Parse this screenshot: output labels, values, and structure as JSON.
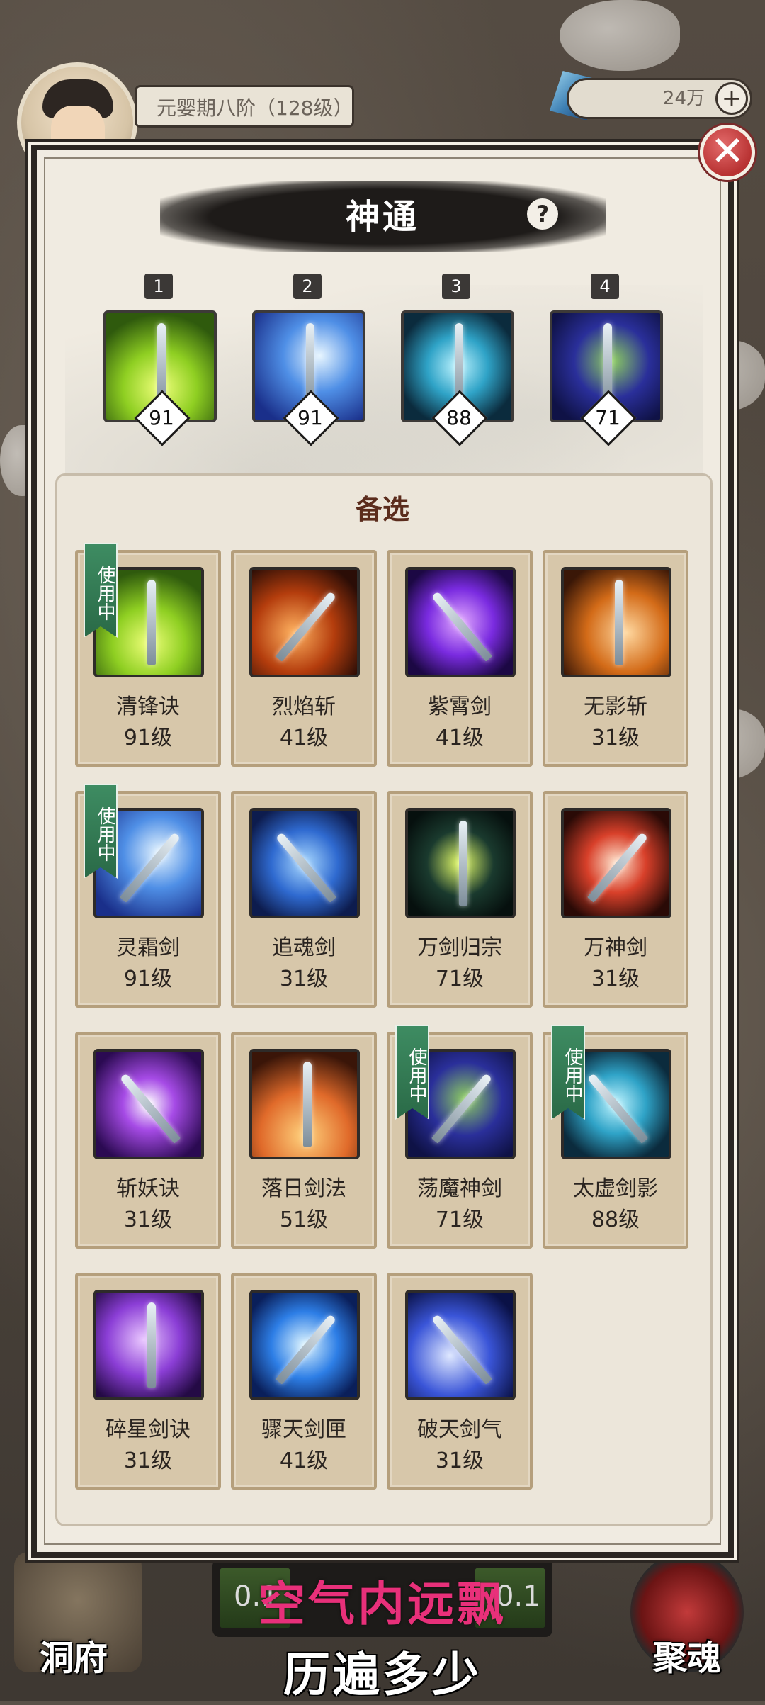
{
  "player": {
    "realm": "元婴期八阶（128级）"
  },
  "currency": {
    "amount": "24万",
    "add_label": "+"
  },
  "modal": {
    "title": "神通",
    "help": "?",
    "close": "✕",
    "candidate_title": "备选"
  },
  "equipped": [
    {
      "slot": "1",
      "level": "91",
      "art": "green"
    },
    {
      "slot": "2",
      "level": "91",
      "art": "ice"
    },
    {
      "slot": "3",
      "level": "88",
      "art": "cyan"
    },
    {
      "slot": "4",
      "level": "71",
      "art": "violet"
    }
  ],
  "in_use_label": "使用中",
  "candidates": [
    {
      "name": "清锋诀",
      "level": "91级",
      "in_use": true,
      "art": "green"
    },
    {
      "name": "烈焰斩",
      "level": "41级",
      "in_use": false,
      "art": "fire"
    },
    {
      "name": "紫霄剑",
      "level": "41级",
      "in_use": false,
      "art": "purple"
    },
    {
      "name": "无影斩",
      "level": "31级",
      "in_use": false,
      "art": "orange"
    },
    {
      "name": "灵霜剑",
      "level": "91级",
      "in_use": true,
      "art": "ice"
    },
    {
      "name": "追魂剑",
      "level": "31级",
      "in_use": false,
      "art": "blue"
    },
    {
      "name": "万剑归宗",
      "level": "71级",
      "in_use": false,
      "art": "dark"
    },
    {
      "name": "万神剑",
      "level": "31级",
      "in_use": false,
      "art": "spiral"
    },
    {
      "name": "斩妖诀",
      "level": "31级",
      "in_use": false,
      "art": "slash"
    },
    {
      "name": "落日剑法",
      "level": "51级",
      "in_use": false,
      "art": "sunset"
    },
    {
      "name": "荡魔神剑",
      "level": "71级",
      "in_use": true,
      "art": "violet"
    },
    {
      "name": "太虚剑影",
      "level": "88级",
      "in_use": true,
      "art": "cyan"
    },
    {
      "name": "碎星剑诀",
      "level": "31级",
      "in_use": false,
      "art": "amethyst"
    },
    {
      "name": "骤天剑匣",
      "level": "41级",
      "in_use": false,
      "art": "triple"
    },
    {
      "name": "破天剑气",
      "level": "31级",
      "in_use": false,
      "art": "vortex"
    }
  ],
  "hud": {
    "left_label": "洞府",
    "right_label": "聚魂",
    "slot_left_text": "0.1",
    "slot_right_text": "0.1"
  },
  "subtitles": {
    "line1": "空气内远飘",
    "line2": "历遍多少"
  }
}
